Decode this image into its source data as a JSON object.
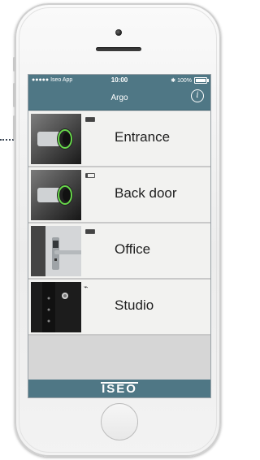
{
  "statusbar": {
    "carrier": "●●●●● Iseo App",
    "time": "10:00",
    "battery_text": "✱ 100%"
  },
  "navbar": {
    "title": "Argo",
    "info_label": "i"
  },
  "doors": [
    {
      "name": "Entrance",
      "indicator": "battery",
      "battery_level": 1.0
    },
    {
      "name": "Back door",
      "indicator": "battery",
      "battery_level": 0.15
    },
    {
      "name": "Office",
      "indicator": "battery",
      "battery_level": 1.0
    },
    {
      "name": "Studio",
      "indicator": "plug"
    }
  ],
  "footer": {
    "logo": "ISEO"
  },
  "colors": {
    "accent": "#4f7785",
    "list_bg": "#f2f2f0",
    "empty_bg": "#d6d6d6"
  }
}
